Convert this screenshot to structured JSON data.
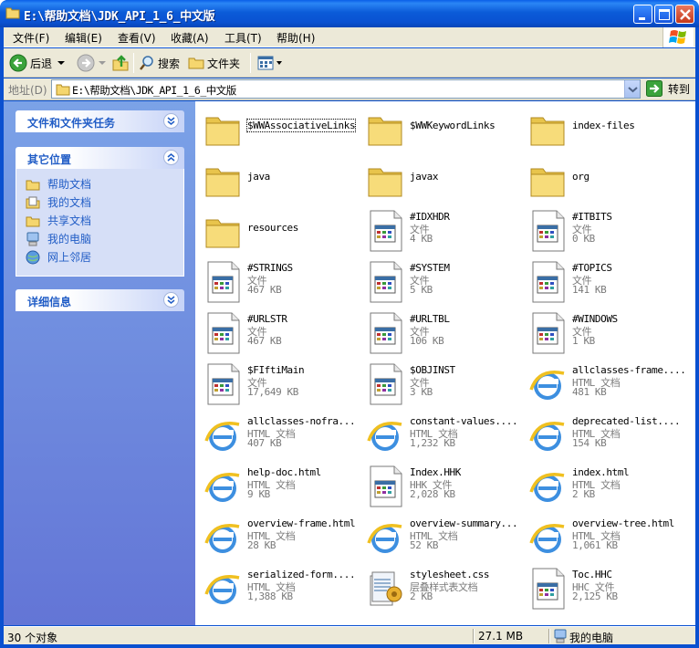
{
  "window": {
    "title": "E:\\帮助文档\\JDK_API_1_6_中文版"
  },
  "menu": [
    "文件(F)",
    "编辑(E)",
    "查看(V)",
    "收藏(A)",
    "工具(T)",
    "帮助(H)"
  ],
  "toolbar": {
    "back_label": "后退",
    "search_label": "搜索",
    "folders_label": "文件夹"
  },
  "address": {
    "label": "地址(D)",
    "path": "E:\\帮助文档\\JDK_API_1_6_中文版",
    "go_label": "转到"
  },
  "left_pane": {
    "tasks_title": "文件和文件夹任务",
    "places_title": "其它位置",
    "places": [
      {
        "label": "帮助文档",
        "icon": "folder-icon"
      },
      {
        "label": "我的文档",
        "icon": "my-documents-icon"
      },
      {
        "label": "共享文档",
        "icon": "folder-icon"
      },
      {
        "label": "我的电脑",
        "icon": "my-computer-icon"
      },
      {
        "label": "网上邻居",
        "icon": "network-icon"
      }
    ],
    "details_title": "详细信息"
  },
  "files": [
    {
      "name": "$WWAssociativeLinks",
      "type": "",
      "size": "",
      "icon": "folder"
    },
    {
      "name": "$WWKeywordLinks",
      "type": "",
      "size": "",
      "icon": "folder"
    },
    {
      "name": "index-files",
      "type": "",
      "size": "",
      "icon": "folder"
    },
    {
      "name": "java",
      "type": "",
      "size": "",
      "icon": "folder"
    },
    {
      "name": "javax",
      "type": "",
      "size": "",
      "icon": "folder"
    },
    {
      "name": "org",
      "type": "",
      "size": "",
      "icon": "folder"
    },
    {
      "name": "resources",
      "type": "",
      "size": "",
      "icon": "folder"
    },
    {
      "name": "#IDXHDR",
      "type": "文件",
      "size": "4 KB",
      "icon": "file"
    },
    {
      "name": "#ITBITS",
      "type": "文件",
      "size": "0 KB",
      "icon": "file"
    },
    {
      "name": "#STRINGS",
      "type": "文件",
      "size": "467 KB",
      "icon": "file"
    },
    {
      "name": "#SYSTEM",
      "type": "文件",
      "size": "5 KB",
      "icon": "file"
    },
    {
      "name": "#TOPICS",
      "type": "文件",
      "size": "141 KB",
      "icon": "file"
    },
    {
      "name": "#URLSTR",
      "type": "文件",
      "size": "467 KB",
      "icon": "file"
    },
    {
      "name": "#URLTBL",
      "type": "文件",
      "size": "106 KB",
      "icon": "file"
    },
    {
      "name": "#WINDOWS",
      "type": "文件",
      "size": "1 KB",
      "icon": "file"
    },
    {
      "name": "$FIftiMain",
      "type": "文件",
      "size": "17,649 KB",
      "icon": "file"
    },
    {
      "name": "$OBJINST",
      "type": "文件",
      "size": "3 KB",
      "icon": "file"
    },
    {
      "name": "allclasses-frame....",
      "type": "HTML 文档",
      "size": "481 KB",
      "icon": "ie"
    },
    {
      "name": "allclasses-nofra...",
      "type": "HTML 文档",
      "size": "407 KB",
      "icon": "ie"
    },
    {
      "name": "constant-values....",
      "type": "HTML 文档",
      "size": "1,232 KB",
      "icon": "ie"
    },
    {
      "name": "deprecated-list....",
      "type": "HTML 文档",
      "size": "154 KB",
      "icon": "ie"
    },
    {
      "name": "help-doc.html",
      "type": "HTML 文档",
      "size": "9 KB",
      "icon": "ie"
    },
    {
      "name": "Index.HHK",
      "type": "HHK 文件",
      "size": "2,028 KB",
      "icon": "file"
    },
    {
      "name": "index.html",
      "type": "HTML 文档",
      "size": "2 KB",
      "icon": "ie"
    },
    {
      "name": "overview-frame.html",
      "type": "HTML 文档",
      "size": "28 KB",
      "icon": "ie"
    },
    {
      "name": "overview-summary...",
      "type": "HTML 文档",
      "size": "52 KB",
      "icon": "ie"
    },
    {
      "name": "overview-tree.html",
      "type": "HTML 文档",
      "size": "1,061 KB",
      "icon": "ie"
    },
    {
      "name": "serialized-form....",
      "type": "HTML 文档",
      "size": "1,388 KB",
      "icon": "ie"
    },
    {
      "name": "stylesheet.css",
      "type": "层叠样式表文档",
      "size": "2 KB",
      "icon": "css"
    },
    {
      "name": "Toc.HHC",
      "type": "HHC 文件",
      "size": "2,125 KB",
      "icon": "file"
    }
  ],
  "status": {
    "count": "30 个对象",
    "size": "27.1 MB",
    "location": "我的电脑"
  }
}
